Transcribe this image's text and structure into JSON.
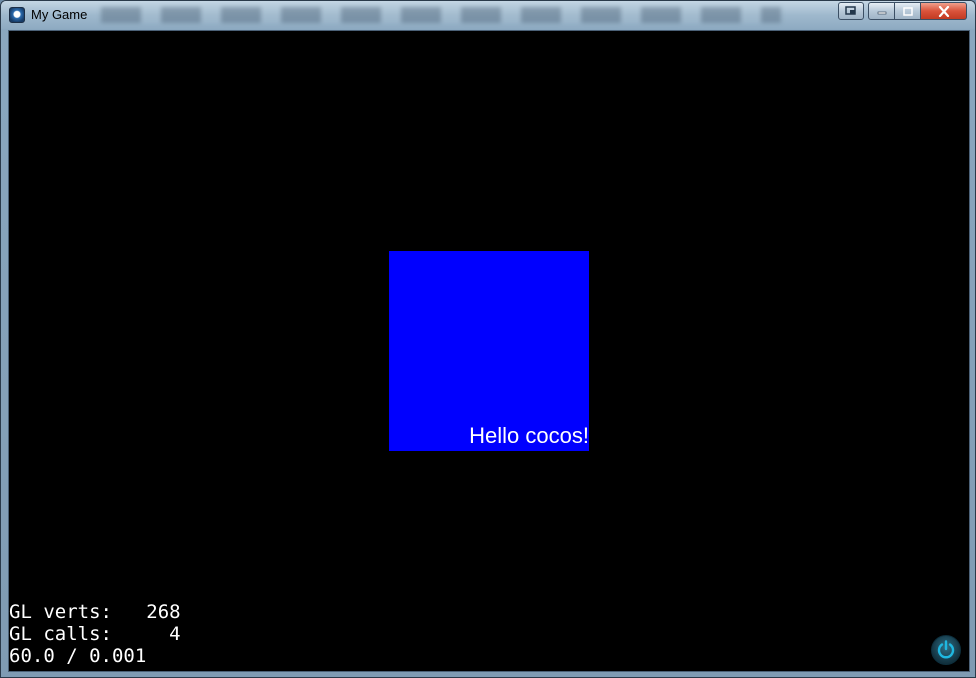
{
  "window": {
    "title": "My Game"
  },
  "caption": {
    "restore_app_icon": "window-restore-app-icon",
    "min_icon": "minimize-icon",
    "max_icon": "maximize-icon",
    "close_icon": "close-icon",
    "close_color": "#d9533b"
  },
  "scene": {
    "background_color": "#000000",
    "square_color": "#0000ff",
    "label": "Hello cocos!"
  },
  "stats": {
    "verts_line": "GL verts:   268",
    "calls_line": "GL calls:     4",
    "fps_line": "60.0 / 0.001"
  },
  "controls": {
    "power_icon": "power-icon",
    "power_color": "#1fb7e0"
  }
}
